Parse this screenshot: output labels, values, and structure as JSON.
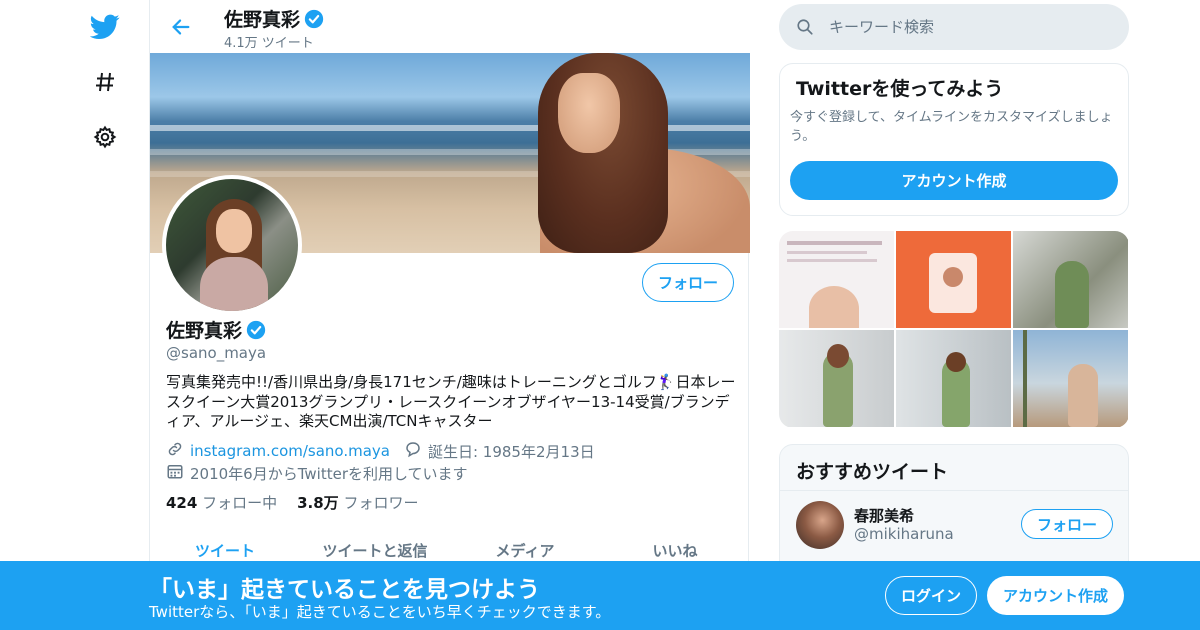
{
  "nav": {
    "icons": [
      "twitter-logo",
      "hashtag-icon",
      "gear-icon"
    ]
  },
  "header": {
    "name": "佐野真彩",
    "tweet_count": "4.1万 ツイート"
  },
  "profile": {
    "name": "佐野真彩",
    "handle": "@sano_maya",
    "follow_label": "フォロー",
    "bio": "写真集発売中!!/香川県出身/身長171センチ/趣味はトレーニングとゴルフ🏌️‍♀️日本レースクイーン大賞2013グランプリ・レースクイーンオブザイヤー13-14受賞/ブランディア、アルージェ、楽天CM出演/TCNキャスター",
    "link": "instagram.com/sano.maya",
    "birthday": "誕生日: 1985年2月13日",
    "joined": "2010年6月からTwitterを利用しています",
    "following_count": "424",
    "following_label": "フォロー中",
    "followers_count": "3.8万",
    "followers_label": "フォロワー"
  },
  "tabs": [
    "ツイート",
    "ツイートと返信",
    "メディア",
    "いいね"
  ],
  "search": {
    "placeholder": "キーワード検索"
  },
  "signup_card": {
    "title": "Twitterを使ってみよう",
    "description": "今すぐ登録して、タイムラインをカスタマイズしましょう。",
    "button": "アカウント作成"
  },
  "recommend": {
    "title": "おすすめツイート",
    "user_name": "春那美希",
    "user_handle": "@mikiharuna",
    "follow_label": "フォロー"
  },
  "bottom_bar": {
    "title": "「いま」起きていることを見つけよう",
    "subtitle": "Twitterなら、「いま」起きていることをいち早くチェックできます。",
    "login": "ログイン",
    "signup": "アカウント作成"
  },
  "colors": {
    "accent": "#1da1f2",
    "text_secondary": "#657786",
    "border": "#e6ecf0"
  }
}
